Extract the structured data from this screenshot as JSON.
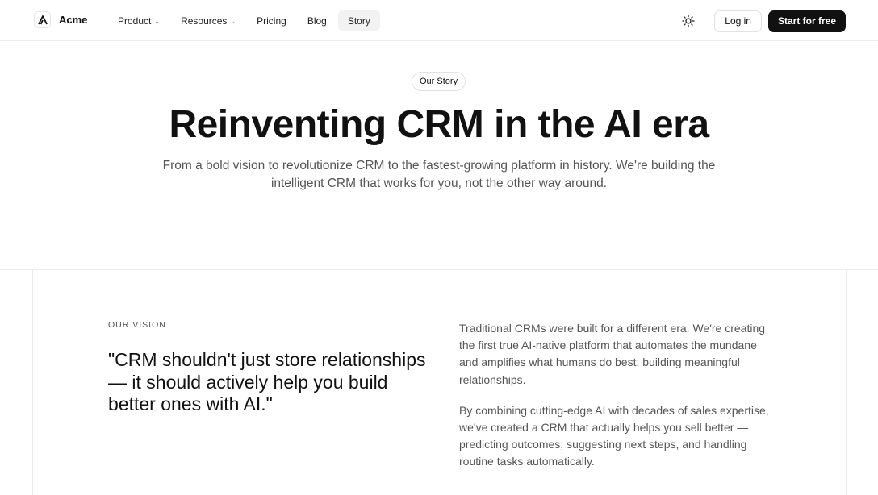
{
  "header": {
    "brand": "Acme",
    "nav": [
      {
        "label": "Product",
        "dropdown": true
      },
      {
        "label": "Resources",
        "dropdown": true
      },
      {
        "label": "Pricing",
        "dropdown": false
      },
      {
        "label": "Blog",
        "dropdown": false
      },
      {
        "label": "Story",
        "dropdown": false,
        "active": true
      }
    ],
    "login_label": "Log in",
    "cta_label": "Start for free",
    "theme_icon": "sun-icon"
  },
  "hero": {
    "badge": "Our Story",
    "title": "Reinventing CRM in the AI era",
    "subtitle": "From a bold vision to revolutionize CRM to the fastest-growing platform in history. We're building the intelligent CRM that works for you, not the other way around."
  },
  "vision": {
    "eyebrow": "OUR VISION",
    "quote": "\"CRM shouldn't just store relationships — it should actively help you build better ones with AI.\"",
    "paragraphs": [
      "Traditional CRMs were built for a different era. We're creating the first true AI-native platform that automates the mundane and amplifies what humans do best: building meaningful relationships.",
      "By combining cutting-edge AI with decades of sales expertise, we've created a CRM that actually helps you sell better — predicting outcomes, suggesting next steps, and handling routine tasks automatically."
    ]
  },
  "colors": {
    "cta_bg": "#111111",
    "active_nav_bg": "#f2f2f2",
    "muted_text": "#555555",
    "border": "#ececec"
  }
}
